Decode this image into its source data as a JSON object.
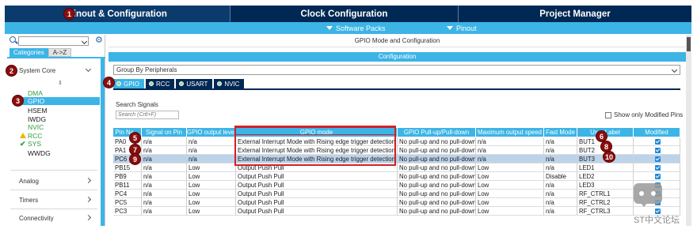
{
  "top_tabs": [
    {
      "label": "Pinout & Configuration"
    },
    {
      "label": "Clock Configuration"
    },
    {
      "label": "Project Manager"
    }
  ],
  "sub_menus": {
    "software_packs": "Software Packs",
    "pinout": "Pinout"
  },
  "left_panel": {
    "categories_tab": "Categories",
    "az_tab": "A->Z",
    "system_core": "System Core",
    "items": [
      "DMA",
      "GPIO",
      "HSEM",
      "IWDG",
      "NVIC",
      "RCC",
      "SYS",
      "WWDG"
    ],
    "analog": "Analog",
    "timers": "Timers",
    "connectivity": "Connectivity"
  },
  "main": {
    "title": "GPIO Mode and Configuration",
    "configuration_label": "Configuration",
    "group_by": "Group By Peripherals",
    "peripheral_tabs": [
      "GPIO",
      "RCC",
      "USART",
      "NVIC"
    ],
    "search_signals_label": "Search Signals",
    "search_placeholder": "Search (Crtl+F)",
    "show_only_modified": "Show only Modified Pins"
  },
  "table": {
    "headers": [
      "Pin Na...",
      "Signal on Pin",
      "GPIO output level",
      "GPIO mode",
      "GPIO Pull-up/Pull-down",
      "Maximum output speed",
      "Fast Mode",
      "User Label",
      "Modified"
    ],
    "rows": [
      [
        "PA0",
        "n/a",
        "n/a",
        "External Interrupt Mode with Rising edge trigger detection",
        "No pull-up and no pull-down",
        "n/a",
        "n/a",
        "BUT1"
      ],
      [
        "PA1",
        "n/a",
        "n/a",
        "External Interrupt Mode with Rising edge trigger detection",
        "No pull-up and no pull-down",
        "n/a",
        "n/a",
        "BUT2"
      ],
      [
        "PC6",
        "n/a",
        "n/a",
        "External Interrupt Mode with Rising edge trigger detection",
        "No pull-up and no pull-down",
        "n/a",
        "n/a",
        "BUT3"
      ],
      [
        "PB15",
        "n/a",
        "Low",
        "Output Push Pull",
        "No pull-up and no pull-down",
        "Low",
        "n/a",
        "LED1"
      ],
      [
        "PB9",
        "n/a",
        "Low",
        "Output Push Pull",
        "No pull-up and no pull-down",
        "Low",
        "Disable",
        "LED2"
      ],
      [
        "PB11",
        "n/a",
        "Low",
        "Output Push Pull",
        "No pull-up and no pull-down",
        "Low",
        "n/a",
        "LED3"
      ],
      [
        "PC4",
        "n/a",
        "Low",
        "Output Push Pull",
        "No pull-up and no pull-down",
        "Low",
        "n/a",
        "RF_CTRL1"
      ],
      [
        "PC5",
        "n/a",
        "Low",
        "Output Push Pull",
        "No pull-up and no pull-down",
        "Low",
        "n/a",
        "RF_CTRL2"
      ],
      [
        "PC3",
        "n/a",
        "Low",
        "Output Push Pull",
        "No pull-up and no pull-down",
        "Low",
        "n/a",
        "RF_CTRL3"
      ]
    ],
    "selected_row": 2
  },
  "annotations": [
    "1",
    "2",
    "3",
    "4",
    "5",
    "6",
    "7",
    "8",
    "9",
    "10"
  ],
  "watermark": "ST中文论坛",
  "colors": {
    "navy": "#002854",
    "cyan": "#3cb4e6",
    "badge": "#8a0e0e",
    "highlight_box": "#d1202a"
  }
}
